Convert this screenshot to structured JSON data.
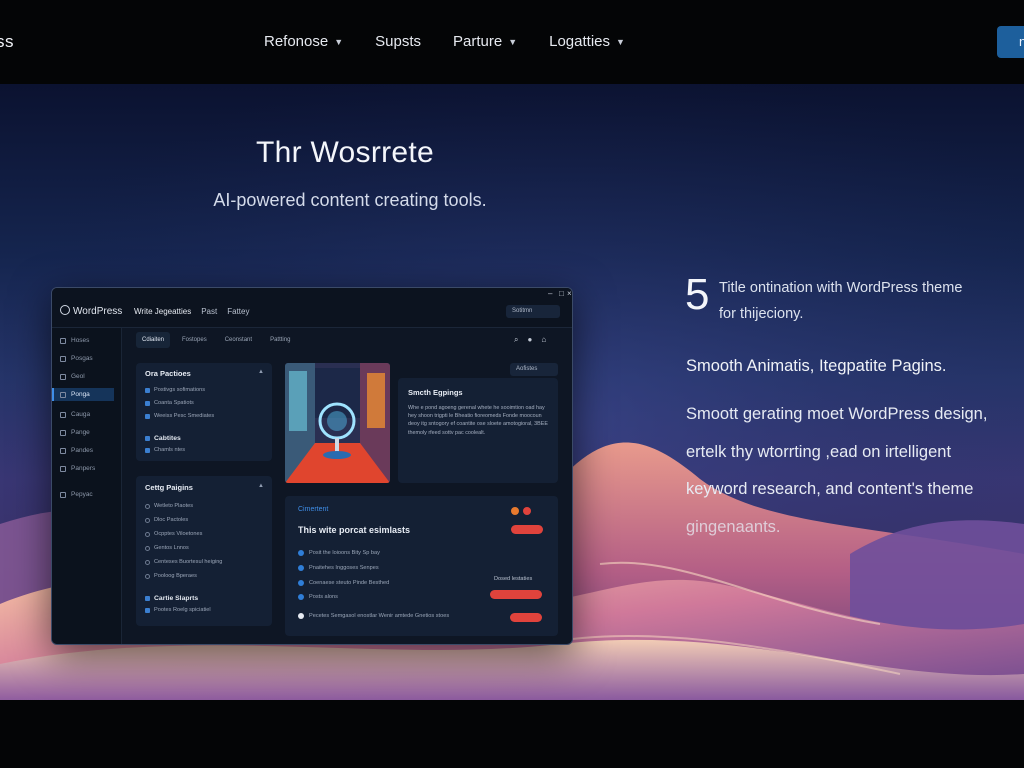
{
  "nav": {
    "logo_fragment": "ss",
    "items": [
      {
        "label": "Refonose",
        "has_dropdown": true
      },
      {
        "label": "Supsts",
        "has_dropdown": false
      },
      {
        "label": "Parture",
        "has_dropdown": true
      },
      {
        "label": "Logatties",
        "has_dropdown": true
      }
    ],
    "cta_label": "n"
  },
  "hero": {
    "title": "Thr Wosrrete",
    "subtitle": "AI-powered content creating tools."
  },
  "app": {
    "brand": "WordPress",
    "menu": [
      "Write Jegeatties",
      "Past",
      "Fattey"
    ],
    "top_pill": "Sotitmn",
    "sidebar": [
      {
        "label": "Hoses",
        "icon": "home-icon"
      },
      {
        "label": "Posgas",
        "icon": "posts-icon"
      },
      {
        "label": "Geol",
        "icon": "tools-icon"
      },
      {
        "label": "Ponga",
        "icon": "pages-icon",
        "active": true
      },
      {
        "label": "Cauga",
        "icon": "edit-icon"
      },
      {
        "label": "Pange",
        "icon": "media-icon"
      },
      {
        "label": "Pandes",
        "icon": "comments-icon"
      },
      {
        "label": "Panpers",
        "icon": "users-icon"
      },
      {
        "label": "Pepyac",
        "icon": "settings-icon"
      }
    ],
    "tabs": [
      "Cdiaiten",
      "Fostopes",
      "Ceonstant",
      "Pattting"
    ],
    "panel1": {
      "title": "Ora Pactioes",
      "items": [
        "Postivgs sofimations",
        "Coanta Spatiots",
        "Weeiss Pesc Smediates"
      ],
      "subtitle": "Cabtites",
      "sub_items": [
        "Chamls ntes"
      ]
    },
    "panel2": {
      "title": "Cettg Paigins",
      "items": [
        "Wetleto Plaotes",
        "Dloc Pactoles",
        "Ocpptes Viloetones",
        "Gentos Lnnos",
        "Centeses Buortesul heiging",
        "Pooloog Bperaes"
      ],
      "footer_title": "Cartie Slaprts",
      "footer_item": "Pootes Roelg spiciatiel"
    },
    "card": {
      "title": "Smcth Egpings",
      "badge": "Aofistes",
      "text": "Whe e pond agoeng gerenal whete he sooimtion oad hay hey shoon trigpti le Bheatio fioreomeds Fonde moocoun deoy itg sntogory ef coantite ose sloete amotogioral, 3BEE themoly rfeed sottv pac coolealt."
    },
    "bottom": {
      "section_label": "Cimertent",
      "title": "This wite porcat esimlasts",
      "lines": [
        "Posit the loioons Bity Sp bay",
        "Pnaitehes Inggoses Senpes",
        "Coenaese steuto Pinde Besthed",
        "Posts alons",
        "Pecetes Semgasol enostlar Wenir amtede Gnetios stoes"
      ],
      "right_label": "Dosed lestaties"
    }
  },
  "feature": {
    "number": "5",
    "headline_1": "Title ontination with WordPress theme",
    "headline_2": "for thijeciony.",
    "subhead": "Smooth Animatis, Itegpatite Pagins.",
    "body_lines": [
      "Smoott gerating moet WordPress design,",
      "ertelk thy wtorrting ,ead on irtelligent",
      "keyword research, and content's theme",
      "gingenaants."
    ]
  },
  "colors": {
    "nav_bg": "#040506",
    "cta": "#1d5f9c",
    "accent_blue": "#3f8ee8",
    "accent_red": "#e0433c"
  }
}
